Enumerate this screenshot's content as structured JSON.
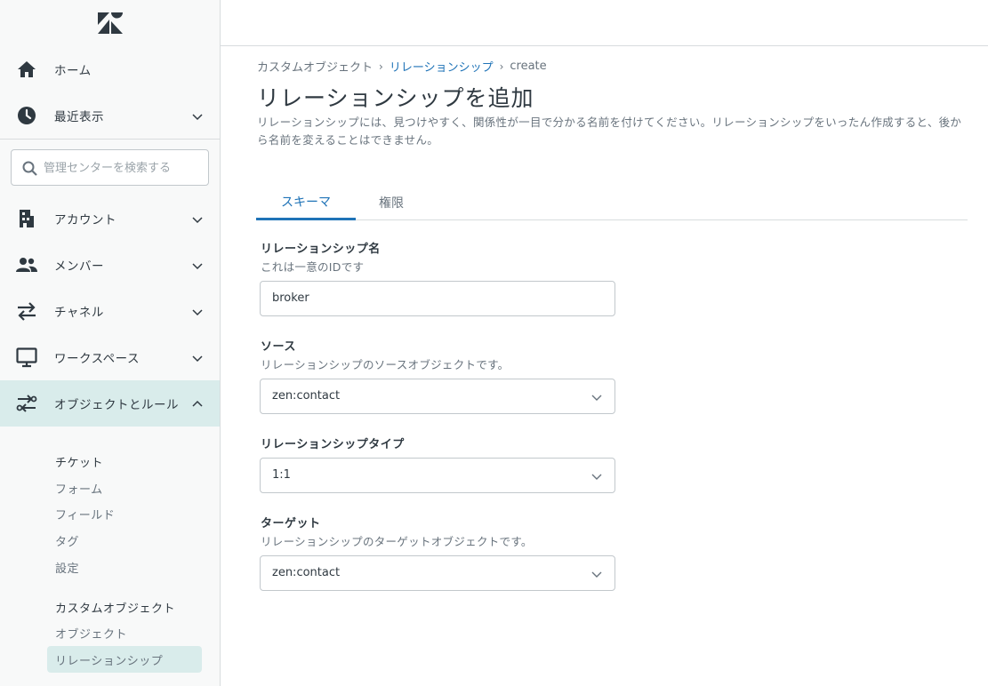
{
  "sidebar": {
    "nav": [
      {
        "label": "ホーム",
        "icon": "home-icon"
      },
      {
        "label": "最近表示",
        "icon": "clock-icon"
      },
      {
        "label": "アカウント",
        "icon": "building-icon"
      },
      {
        "label": "メンバー",
        "icon": "people-icon"
      },
      {
        "label": "チャネル",
        "icon": "arrows-icon"
      },
      {
        "label": "ワークスペース",
        "icon": "monitor-icon"
      },
      {
        "label": "オブジェクトとルール",
        "icon": "objects-rules-icon"
      }
    ],
    "search_placeholder": "管理センターを検索する",
    "sub_items": [
      "チケット",
      "フォーム",
      "フィールド",
      "タグ",
      "設定"
    ],
    "custom_objects_heading": "カスタムオブジェクト",
    "custom_items": [
      "オブジェクト",
      "リレーションシップ"
    ]
  },
  "breadcrumb": [
    "カスタムオブジェクト",
    "リレーションシップ",
    "create"
  ],
  "page_title": "リレーションシップを追加",
  "description": "リレーションシップには、見つけやすく、関係性が一目で分かる名前を付けてください。リレーションシップをいったん作成すると、後から名前を変えることはできません。",
  "tabs": [
    "スキーマ",
    "権限"
  ],
  "form": {
    "name": {
      "label": "リレーションシップ名",
      "hint": "これは一意のIDです",
      "value": "broker"
    },
    "source": {
      "label": "ソース",
      "hint": "リレーションシップのソースオブジェクトです。",
      "value": "zen:contact"
    },
    "type": {
      "label": "リレーションシップタイプ",
      "value": "1:1"
    },
    "target": {
      "label": "ターゲット",
      "hint": "リレーションシップのターゲットオブジェクトです。",
      "value": "zen:contact"
    }
  },
  "colors": {
    "accent": "#1f73b7",
    "active_bg": "#d9eceb",
    "text": "#2f3941",
    "muted": "#68737d"
  }
}
